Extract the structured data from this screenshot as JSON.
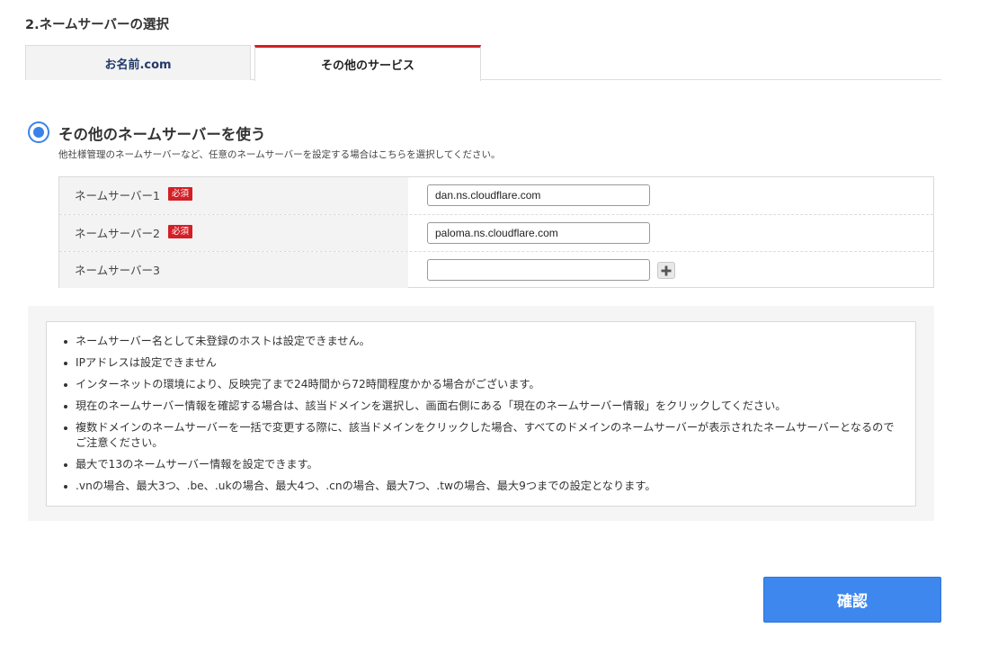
{
  "section": {
    "title": "2.ネームサーバーの選択"
  },
  "tabs": [
    {
      "label": "お名前.com",
      "active": false
    },
    {
      "label": "その他のサービス",
      "active": true
    }
  ],
  "option": {
    "label": "その他のネームサーバーを使う",
    "description": "他社様管理のネームサーバーなど、任意のネームサーバーを設定する場合はこちらを選択してください。",
    "selected": true
  },
  "nameservers": [
    {
      "label": "ネームサーバー1",
      "required_badge": "必須",
      "value": "dan.ns.cloudflare.com"
    },
    {
      "label": "ネームサーバー2",
      "required_badge": "必須",
      "value": "paloma.ns.cloudflare.com"
    },
    {
      "label": "ネームサーバー3",
      "value": ""
    }
  ],
  "notes": [
    "ネームサーバー名として未登録のホストは設定できません。",
    "IPアドレスは設定できません",
    "インターネットの環境により、反映完了まで24時間から72時間程度かかる場合がございます。",
    "現在のネームサーバー情報を確認する場合は、該当ドメインを選択し、画面右側にある「現在のネームサーバー情報」をクリックしてください。",
    "複数ドメインのネームサーバーを一括で変更する際に、該当ドメインをクリックした場合、すべてのドメインのネームサーバーが表示されたネームサーバーとなるのでご注意ください。",
    "最大で13のネームサーバー情報を設定できます。",
    ".vnの場合、最大3つ、.be、.ukの場合、最大4つ、.cnの場合、最大7つ、.twの場合、最大9つまでの設定となります。"
  ],
  "confirm_button": {
    "label": "確認"
  },
  "colors": {
    "accent": "#3d87ee",
    "active_tab": "#d31f26",
    "required": "#d31f26"
  }
}
